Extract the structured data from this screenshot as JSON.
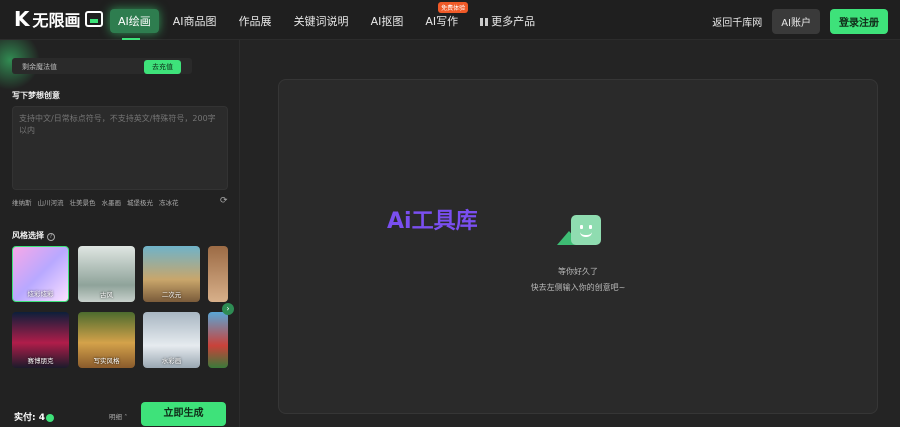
{
  "header": {
    "logo_text": "无限画",
    "nav": [
      {
        "label": "AI绘画",
        "active": true
      },
      {
        "label": "AI商品图"
      },
      {
        "label": "作品展"
      },
      {
        "label": "关键词说明"
      },
      {
        "label": "AI抠图"
      },
      {
        "label": "AI写作",
        "badge": "免费体验"
      },
      {
        "label": "更多产品"
      }
    ],
    "home_link": "返回千库网",
    "account_button": "AI账户",
    "login_button": "登录注册"
  },
  "sidebar": {
    "credits_label": "剩余魔法值",
    "recharge_label": "去充值",
    "prompt_title": "写下梦想创意",
    "prompt_placeholder": "支持中文/日常标点符号，不支持英文/特殊符号，200字以内",
    "tags": [
      "维纳斯",
      "山川河流",
      "壮美景色",
      "水墨画",
      "城堡极光",
      "冻冰花"
    ],
    "style_title": "风格选择",
    "styles": [
      {
        "label": "炫彩炫彩"
      },
      {
        "label": "古风"
      },
      {
        "label": "二次元"
      },
      {
        "label": ""
      },
      {
        "label": "赛博朋克"
      },
      {
        "label": "写实风格"
      },
      {
        "label": "水彩画"
      },
      {
        "label": ""
      }
    ],
    "price_label": "实付: 4",
    "detail_label": "明细",
    "generate_button": "立即生成"
  },
  "canvas": {
    "watermark": "Ai工具库",
    "waiting_line1": "等你好久了",
    "waiting_line2": "快去左侧输入你的创意吧~"
  },
  "colors": {
    "accent": "#3ee27a",
    "background": "#242424",
    "watermark": "#7a4ff0"
  }
}
